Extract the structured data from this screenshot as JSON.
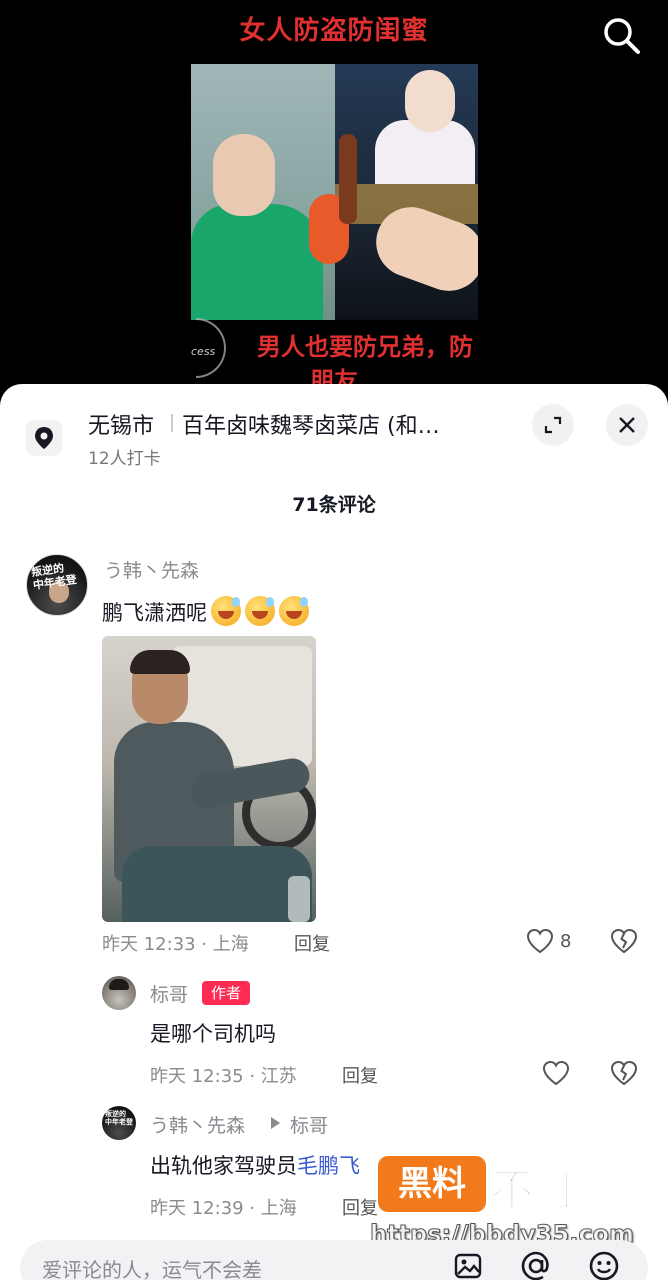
{
  "video": {
    "title": "女人防盗防闺蜜",
    "subtitle_line1": "男人也要防兄弟，防",
    "subtitle_line2": "朋友",
    "deco_text": "cess"
  },
  "location": {
    "city": "无锡市",
    "shop": "百年卤味魏琴卤菜店 (和…",
    "checkins": "12人打卡"
  },
  "comments_header": "71条评论",
  "comment_main": {
    "user": "う韩丶先森",
    "text": "鹏飞潇洒呢",
    "avatar_text": "叛逆的\n中年老登",
    "time_loc": "昨天 12:33 · 上海",
    "reply_label": "回复",
    "likes": "8"
  },
  "reply1": {
    "user": "标哥",
    "tag": "作者",
    "text": "是哪个司机吗",
    "time_loc": "昨天 12:35 · 江苏",
    "reply_label": "回复"
  },
  "reply2": {
    "user": "う韩丶先森",
    "to_user": "标哥",
    "text_before": "出轨他家驾驶员",
    "mention": "毛鹏飞",
    "time_loc": "昨天 12:39 · 上海",
    "reply_label": "回复"
  },
  "watermark": {
    "box": "黑料",
    "text": "不打烊",
    "url": "https://bbdy35.com"
  },
  "input": {
    "placeholder": "爱评论的人，运气不会差"
  },
  "icons": [
    "search-icon",
    "location-pin-icon",
    "expand-icon",
    "close-icon",
    "heart-icon",
    "dislike-heart-icon",
    "image-icon",
    "at-icon",
    "emoji-icon"
  ]
}
